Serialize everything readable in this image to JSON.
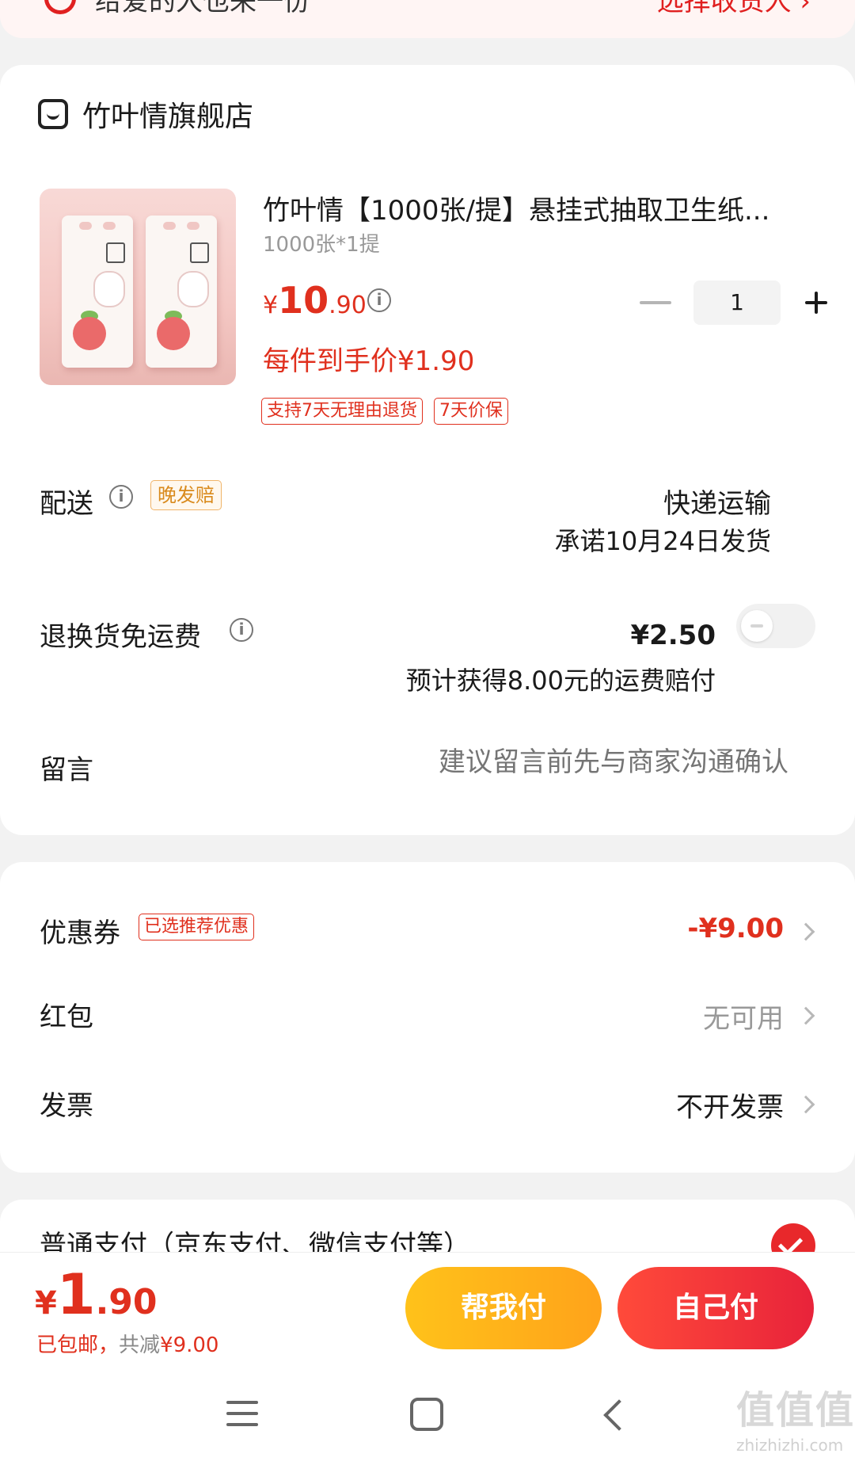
{
  "top_banner": {
    "left_text": "给爱的人也来一份",
    "right_text": "选择收货人 ›"
  },
  "store": {
    "name": "竹叶情旗舰店"
  },
  "product": {
    "title": "竹叶情【1000张/提】悬挂式抽取卫生纸...",
    "spec": "1000张*1提",
    "price_currency": "¥",
    "price_int": "10",
    "price_dec": ".90",
    "quantity": "1",
    "net_price": "每件到手价¥1.90",
    "tags": [
      "支持7天无理由退货",
      "7天价保"
    ]
  },
  "delivery": {
    "label": "配送",
    "late_tag": "晚发赔",
    "method": "快递运输",
    "promise": "承诺10月24日发货"
  },
  "return_shipping": {
    "label": "退换货免运费",
    "price": "¥2.50",
    "note": "预计获得8.00元的运费赔付",
    "enabled": false
  },
  "message": {
    "label": "留言",
    "placeholder": "建议留言前先与商家沟通确认"
  },
  "discounts": {
    "coupon_label": "优惠券",
    "coupon_tag": "已选推荐优惠",
    "coupon_value": "-¥9.00",
    "redpacket_label": "红包",
    "redpacket_value": "无可用",
    "invoice_label": "发票",
    "invoice_value": "不开发票"
  },
  "payment": {
    "method_label": "普通支付（京东支付、微信支付等）",
    "selected": true
  },
  "footer": {
    "total_currency": "¥",
    "total_int": "1",
    "total_dec": ".90",
    "shipping_free": "已包邮，",
    "saved_prefix": "共减",
    "saved_amount": "¥9.00",
    "help_pay_label": "帮我付",
    "self_pay_label": "自己付"
  },
  "watermark": {
    "text": "值值值",
    "sub": "zhizhizhi.com"
  },
  "colors": {
    "accent_red": "#e0301e",
    "pay_button_red": "#e8233a",
    "help_button_yellow": "#ffb81a",
    "late_tag_orange": "#d98a1c"
  },
  "icons": [
    "shield-icon",
    "store-icon",
    "info-icon",
    "minus-icon",
    "plus-icon",
    "chevron-right-icon",
    "check-icon",
    "menu-icon",
    "home-icon",
    "back-icon"
  ]
}
